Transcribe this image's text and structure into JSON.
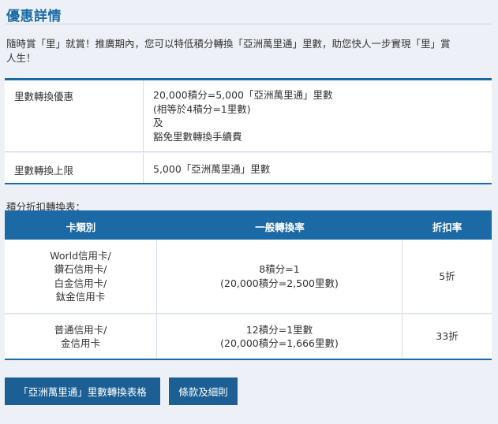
{
  "page": {
    "title": "優惠詳情",
    "intro_line1": "隨時賞「里」就賞！推廣期內，您可以特低積分轉換「亞洲萬里通」里數，助您快人一步實現「里」賞",
    "intro_line2": "人生！"
  },
  "summary": {
    "rows": [
      {
        "label": "里數轉換優惠",
        "lines": [
          "20,000積分=5,000「亞洲萬里通」里數",
          "(相等於4積分=1里數)",
          "及",
          "豁免里數轉換手續費"
        ]
      },
      {
        "label": "里數轉換上限",
        "lines": [
          "5,000「亞洲萬里通」里數"
        ]
      }
    ]
  },
  "conversion": {
    "caption": "積分折扣轉換表：",
    "headers": {
      "card": "卡類別",
      "rate": "一般轉換率",
      "discount": "折扣率"
    },
    "rows": [
      {
        "card_lines": [
          "World信用卡/",
          "鑽石信用卡/",
          "白金信用卡/",
          "鈦金信用卡"
        ],
        "rate_lines": [
          "8積分=1",
          "(20,000積分=2,500里數)"
        ],
        "discount": "5折"
      },
      {
        "card_lines": [
          "普通信用卡/",
          "金信用卡"
        ],
        "rate_lines": [
          "12積分=1里數",
          "(20,000積分=1,666里數)"
        ],
        "discount": "33折"
      }
    ]
  },
  "buttons": {
    "table_label": "「亞洲萬里通」里數轉換表格",
    "terms_label": "條款及細則"
  },
  "colors": {
    "accent": "#1b6aa5",
    "button": "#1b5f95",
    "background": "#edf1f7"
  }
}
